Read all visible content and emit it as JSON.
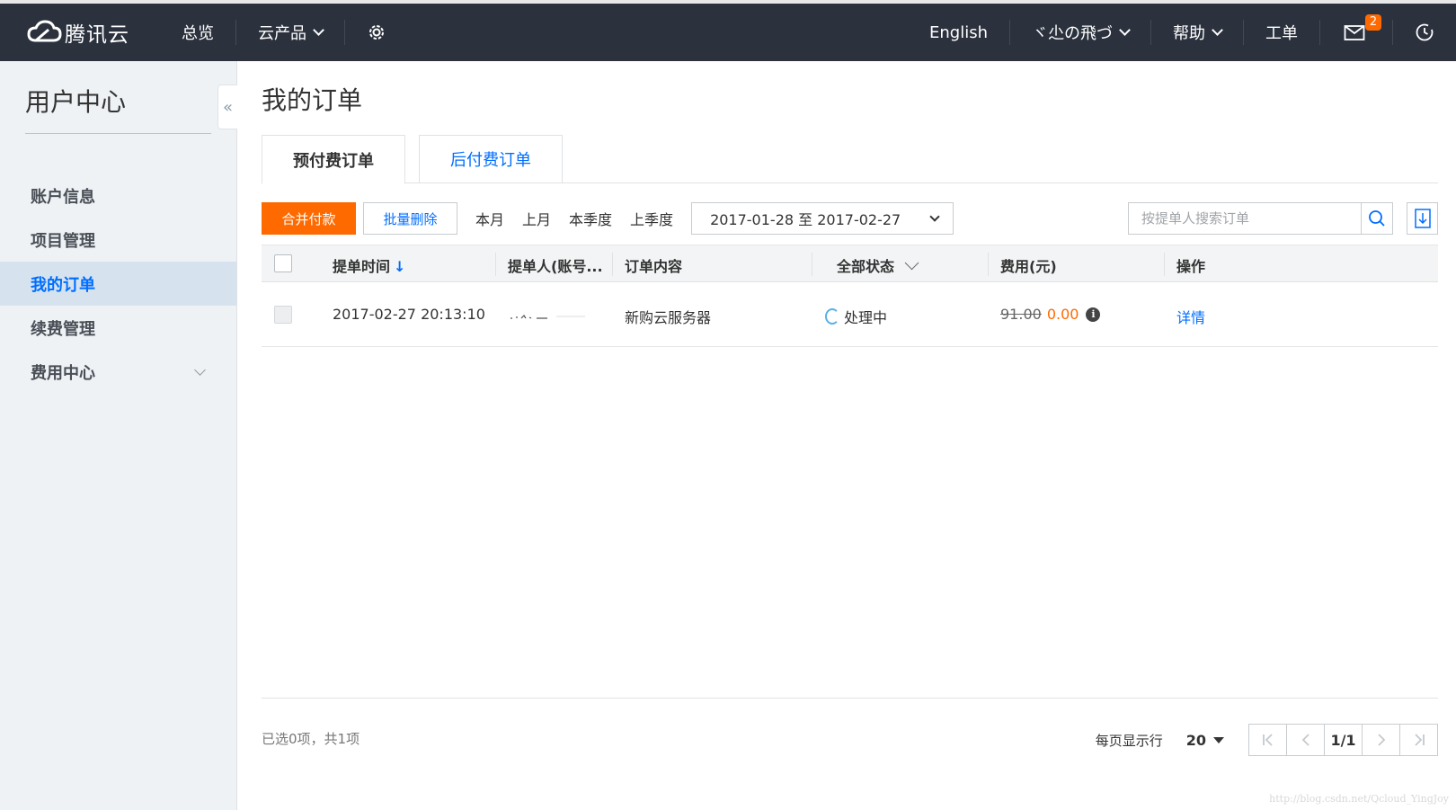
{
  "topbar": {
    "brand": "腾讯云",
    "overview": "总览",
    "products": "云产品",
    "language": "English",
    "username": "ヾ尐の飛づ",
    "help": "帮助",
    "ticket": "工单",
    "messages_count": "2"
  },
  "sidebar": {
    "title": "用户中心",
    "items": [
      {
        "label": "账户信息"
      },
      {
        "label": "项目管理"
      },
      {
        "label": "我的订单"
      },
      {
        "label": "续费管理"
      },
      {
        "label": "费用中心"
      }
    ],
    "active_index": 2,
    "collapse_icon": "«"
  },
  "main": {
    "title": "我的订单",
    "tabs": [
      {
        "label": "预付费订单"
      },
      {
        "label": "后付费订单"
      }
    ],
    "toolbar": {
      "merge_pay": "合并付款",
      "batch_delete": "批量删除",
      "quick_ranges": [
        "本月",
        "上月",
        "本季度",
        "上季度"
      ],
      "date_range": "2017-01-28 至 2017-02-27",
      "search_placeholder": "按提单人搜索订单"
    },
    "table": {
      "headers": {
        "time": "提单时间",
        "submitter": "提单人(账号...",
        "content": "订单内容",
        "status": "全部状态",
        "fee": "费用(元)",
        "action": "操作"
      },
      "rows": [
        {
          "time": "2017-02-27 20:13:10",
          "content": "新购云服务器",
          "status": "处理中",
          "original_price": "91.00",
          "price": "0.00",
          "action": "详情"
        }
      ]
    },
    "footer": {
      "selection": "已选0项，共1项",
      "per_page_label": "每页显示行",
      "per_page": "20",
      "page": "1/1"
    }
  },
  "watermark": "http://blog.csdn.net/Qcloud_YingJoy",
  "colors": {
    "topbar": "#2b323e",
    "accent": "#006eff",
    "orange": "#ff6a00",
    "sidebar": "#eef2f5"
  }
}
